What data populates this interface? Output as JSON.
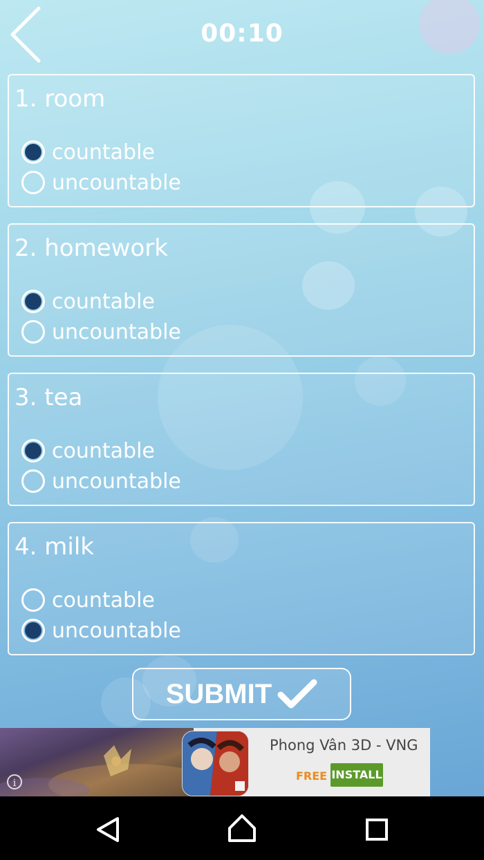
{
  "header": {
    "timer": "00:10"
  },
  "questions": [
    {
      "title": "1. room",
      "options": [
        {
          "label": "countable",
          "selected": true
        },
        {
          "label": "uncountable",
          "selected": false
        }
      ]
    },
    {
      "title": "2. homework",
      "options": [
        {
          "label": "countable",
          "selected": true
        },
        {
          "label": "uncountable",
          "selected": false
        }
      ]
    },
    {
      "title": "3. tea",
      "options": [
        {
          "label": "countable",
          "selected": true
        },
        {
          "label": "uncountable",
          "selected": false
        }
      ]
    },
    {
      "title": "4. milk",
      "options": [
        {
          "label": "countable",
          "selected": false
        },
        {
          "label": "uncountable",
          "selected": true
        }
      ]
    }
  ],
  "submit": {
    "label": "SUBMIT",
    "icon": "checkmark-icon"
  },
  "ad": {
    "title": "Phong Vân 3D - VNG",
    "price": "FREE",
    "install_label": "INSTALL",
    "info_icon": "info-icon",
    "brand_color_free": "#ef8a1d",
    "brand_color_install": "#5b9a2a"
  },
  "colors": {
    "selected_radio": "#1b3f6b"
  },
  "navbar": {
    "icons": [
      "back-triangle-icon",
      "home-icon",
      "recents-square-icon"
    ]
  }
}
